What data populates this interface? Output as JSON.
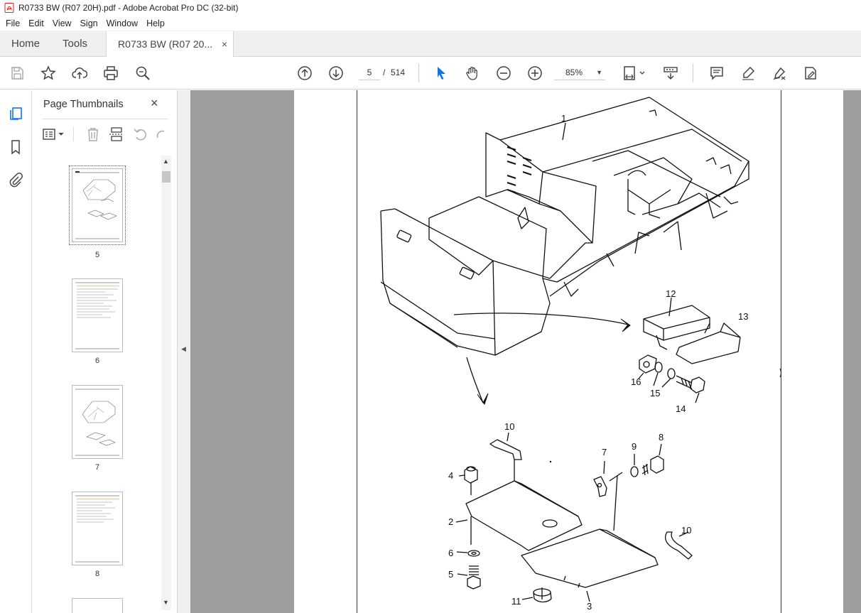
{
  "window": {
    "title": "R0733 BW (R07 20H).pdf - Adobe Acrobat Pro DC (32-bit)"
  },
  "menu": [
    "File",
    "Edit",
    "View",
    "Sign",
    "Window",
    "Help"
  ],
  "tabs": {
    "home": "Home",
    "tools": "Tools",
    "document": "R0733 BW (R07 20...",
    "close": "×"
  },
  "toolbar": {
    "current_page": "5",
    "page_separator": "/",
    "total_pages": "514",
    "zoom": "85%"
  },
  "panel": {
    "title": "Page Thumbnails",
    "close": "×",
    "thumbnails": [
      {
        "label": "5",
        "selected": true
      },
      {
        "label": "6",
        "selected": false
      },
      {
        "label": "7",
        "selected": false
      },
      {
        "label": "8",
        "selected": false
      }
    ]
  },
  "drawing": {
    "callouts": [
      "1",
      "12",
      "13",
      "16",
      "15",
      "14",
      "10",
      "4",
      "2",
      "6",
      "5",
      "7",
      "9",
      "8",
      "10",
      "11",
      "3"
    ]
  },
  "colors": {
    "accent": "#1473e6",
    "canvas": "#9e9e9e",
    "pdf_red": "#d9261c"
  }
}
